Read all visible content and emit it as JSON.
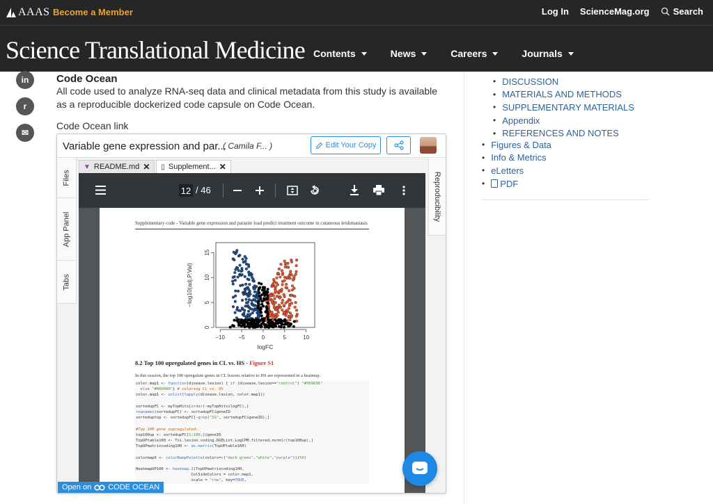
{
  "topbar": {
    "logo_text": "AAAS",
    "become_member": "Become a Member",
    "login": "Log In",
    "sciencemag": "ScienceMag.org",
    "search": "Search"
  },
  "header": {
    "brand": "Science Translational Medicine",
    "nav": [
      "Contents",
      "News",
      "Careers",
      "Journals"
    ]
  },
  "social": [
    "in",
    "r",
    "✉"
  ],
  "article": {
    "section_title": "Code Ocean",
    "description": "All code used to analyze RNA-seq data and clinical metadata from this study is available as a reproducible dockerized code capsule on Code Ocean.",
    "link_label": "Code Ocean link"
  },
  "sidebar": {
    "subsections": [
      "DISCUSSION",
      "MATERIALS AND METHODS",
      "SUPPLEMENTARY MATERIALS",
      "Appendix",
      "REFERENCES AND NOTES"
    ],
    "sections": [
      "Figures & Data",
      "Info & Metrics",
      "eLetters",
      "PDF"
    ]
  },
  "capsule": {
    "title": "Variable gene expression and par...",
    "author": "( Camila F... )",
    "edit_label": "Edit Your Copy",
    "left_tabs": [
      "Files",
      "App Panel",
      "Tabs"
    ],
    "right_tab": "Reproducibility",
    "file_tabs": [
      "README.md",
      "Supplement..."
    ],
    "open_on": "Open on",
    "open_on_brand": "CODE OCEAN",
    "accent_color": "#2a8ee0"
  },
  "pdf": {
    "current_page": "12",
    "total_pages": "/ 46",
    "header_text": "Supplementary code - Variable gene expression and parasite load predict treatment outcome in cutaneous leishmaniasis",
    "section_heading": "8.2   Top 100 upregulated genes in CL vs. HS - ",
    "figure_ref": "Figure S1",
    "section_para": "In this session, the top 100 upregulate genes in CL lesions relative to HS are represented in a heatmap."
  },
  "chart_data": {
    "type": "scatter",
    "xlabel": "logFC",
    "ylabel": "−log10(adj.P.Val)",
    "xticks": [
      "−10",
      "−5",
      "0",
      "5",
      "10"
    ],
    "yticks": [
      "0",
      "5",
      "10",
      "15"
    ],
    "xlim": [
      -11,
      12
    ],
    "ylim": [
      0,
      17
    ],
    "series": [
      {
        "color": "#1f4e8c"
      },
      {
        "color": "#e8552d"
      },
      {
        "color": "#000000"
      }
    ]
  }
}
